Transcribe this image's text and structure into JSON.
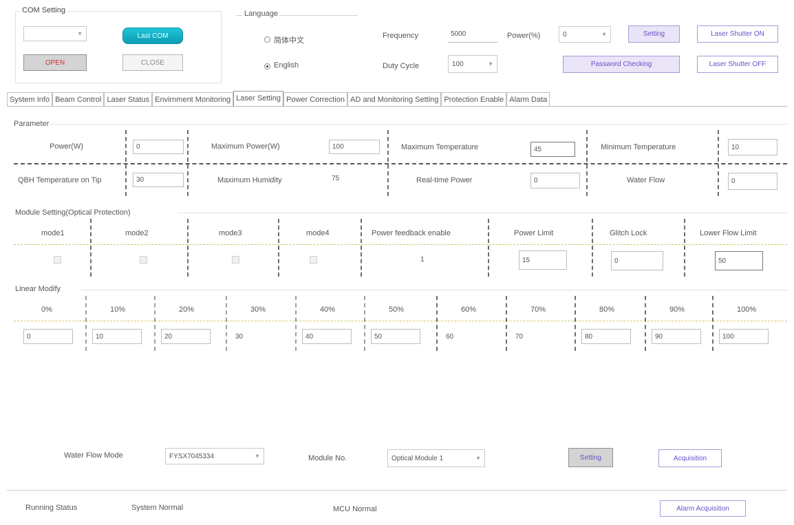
{
  "com": {
    "title": "COM Setting",
    "port_value": "",
    "connect_label": "Last COM",
    "open_label": "OPEN",
    "close_label": "CLOSE"
  },
  "language": {
    "title": "Language",
    "chinese_label": "简体中文",
    "english_label": "English"
  },
  "top": {
    "frequency_label": "Frequency",
    "frequency_value": "5000",
    "power_label": "Power(%)",
    "power_value": "0",
    "duty_label": "Duty Cycle",
    "duty_value": "100",
    "setting_label": "Setting",
    "password_label": "Password Checking",
    "shutter_on_label": "Laser Shutter ON",
    "shutter_off_label": "Laser Shutter OFF"
  },
  "tabs": [
    {
      "label": "System Info"
    },
    {
      "label": "Beam Control"
    },
    {
      "label": "Laser Status"
    },
    {
      "label": "Envirnment Monitoring"
    },
    {
      "label": "Laser Setting"
    },
    {
      "label": "Power Correction"
    },
    {
      "label": "AD and Monitoring Setting"
    },
    {
      "label": "Protection Enable"
    },
    {
      "label": "Alarm Data"
    }
  ],
  "parameter": {
    "title": "Parameter",
    "fields": [
      {
        "label": "Power(W)",
        "value": "0"
      },
      {
        "label": "Maximum Power(W)",
        "value": "100"
      },
      {
        "label": "Maximum Temperature",
        "value": "45"
      },
      {
        "label": "Minimum Temperature",
        "value": "10"
      },
      {
        "label": "QBH Temperature on Tip",
        "value": "30"
      },
      {
        "label": "Maximum Humidity",
        "value": "75"
      },
      {
        "label": "Real-time Power",
        "value": "0"
      },
      {
        "label": "Water Flow",
        "value": "0"
      }
    ]
  },
  "module": {
    "title": "Module Setting(Optical Protection)",
    "headers": [
      "mode1",
      "mode2",
      "mode3",
      "mode4",
      "Power feedback enable",
      "Power Limit",
      "Glitch Lock",
      "Lower Flow Limit"
    ],
    "power_feedback_value": "1",
    "power_limit": "15",
    "glitch_lock": "0",
    "lower_flow_limit": "50"
  },
  "linear": {
    "title": "Linear Modify",
    "headers": [
      "0%",
      "10%",
      "20%",
      "30%",
      "40%",
      "50%",
      "60%",
      "70%",
      "80%",
      "90%",
      "100%"
    ],
    "values": [
      "0",
      "10",
      "20",
      "30",
      "40",
      "50",
      "60",
      "70",
      "80",
      "90",
      "100"
    ]
  },
  "bottom": {
    "water_flow_mode_label": "Water Flow Mode",
    "water_flow_mode_value": "FYSX7045334",
    "module_no_label": "Module No.",
    "module_no_value": "Optical Module 1",
    "setting_label": "Setting",
    "acquisition_label": "Acquisition"
  },
  "status": {
    "running_label": "Running Status",
    "system_status": "System Normal",
    "mcu_status": "MCU Normal",
    "alarm_acq_label": "Alarm Acquisition"
  }
}
